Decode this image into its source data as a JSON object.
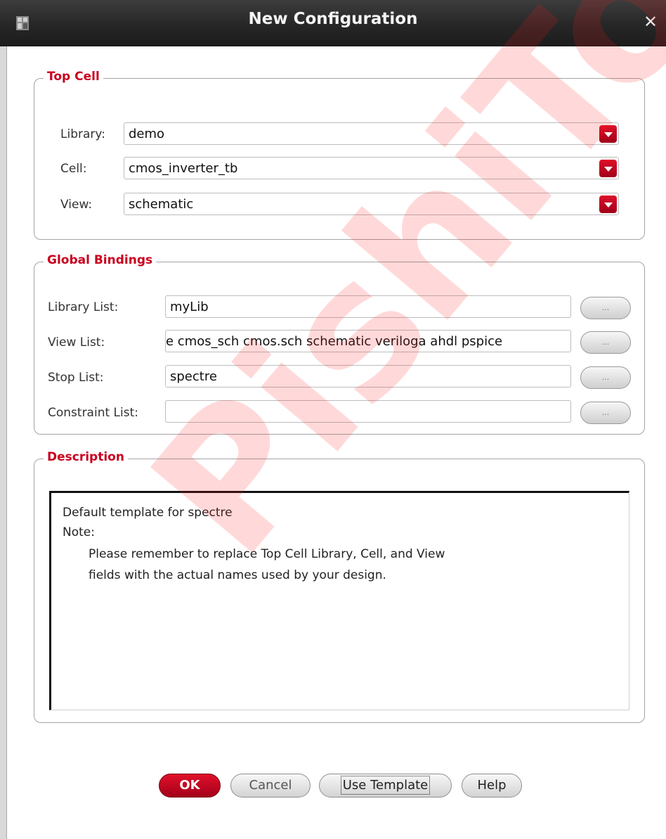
{
  "window": {
    "title": "New Configuration"
  },
  "top_cell": {
    "legend": "Top Cell",
    "library": {
      "label": "Library:",
      "value": "demo"
    },
    "cell": {
      "label": "Cell:",
      "value": "cmos_inverter_tb"
    },
    "view": {
      "label": "View:",
      "value": "schematic"
    }
  },
  "global_bindings": {
    "legend": "Global Bindings",
    "library_list": {
      "label": "Library List:",
      "value": "myLib",
      "button": "..."
    },
    "view_list": {
      "label": "View List:",
      "value": "e cmos_sch cmos.sch schematic veriloga ahdl pspice",
      "button": "..."
    },
    "stop_list": {
      "label": "Stop List:",
      "value": "spectre",
      "button": "..."
    },
    "constraint_list": {
      "label": "Constraint List:",
      "value": "",
      "button": "..."
    }
  },
  "description": {
    "legend": "Description",
    "lines": [
      "Default template for spectre",
      "Note:",
      "Please remember to replace Top Cell Library, Cell, and View",
      "fields with the actual names used by your design."
    ]
  },
  "buttons": {
    "ok": "OK",
    "cancel": "Cancel",
    "use_template": "Use Template",
    "help": "Help"
  },
  "watermark": "PishiToo",
  "colors": {
    "accent": "#c8001e",
    "titlebar": "#262626"
  }
}
